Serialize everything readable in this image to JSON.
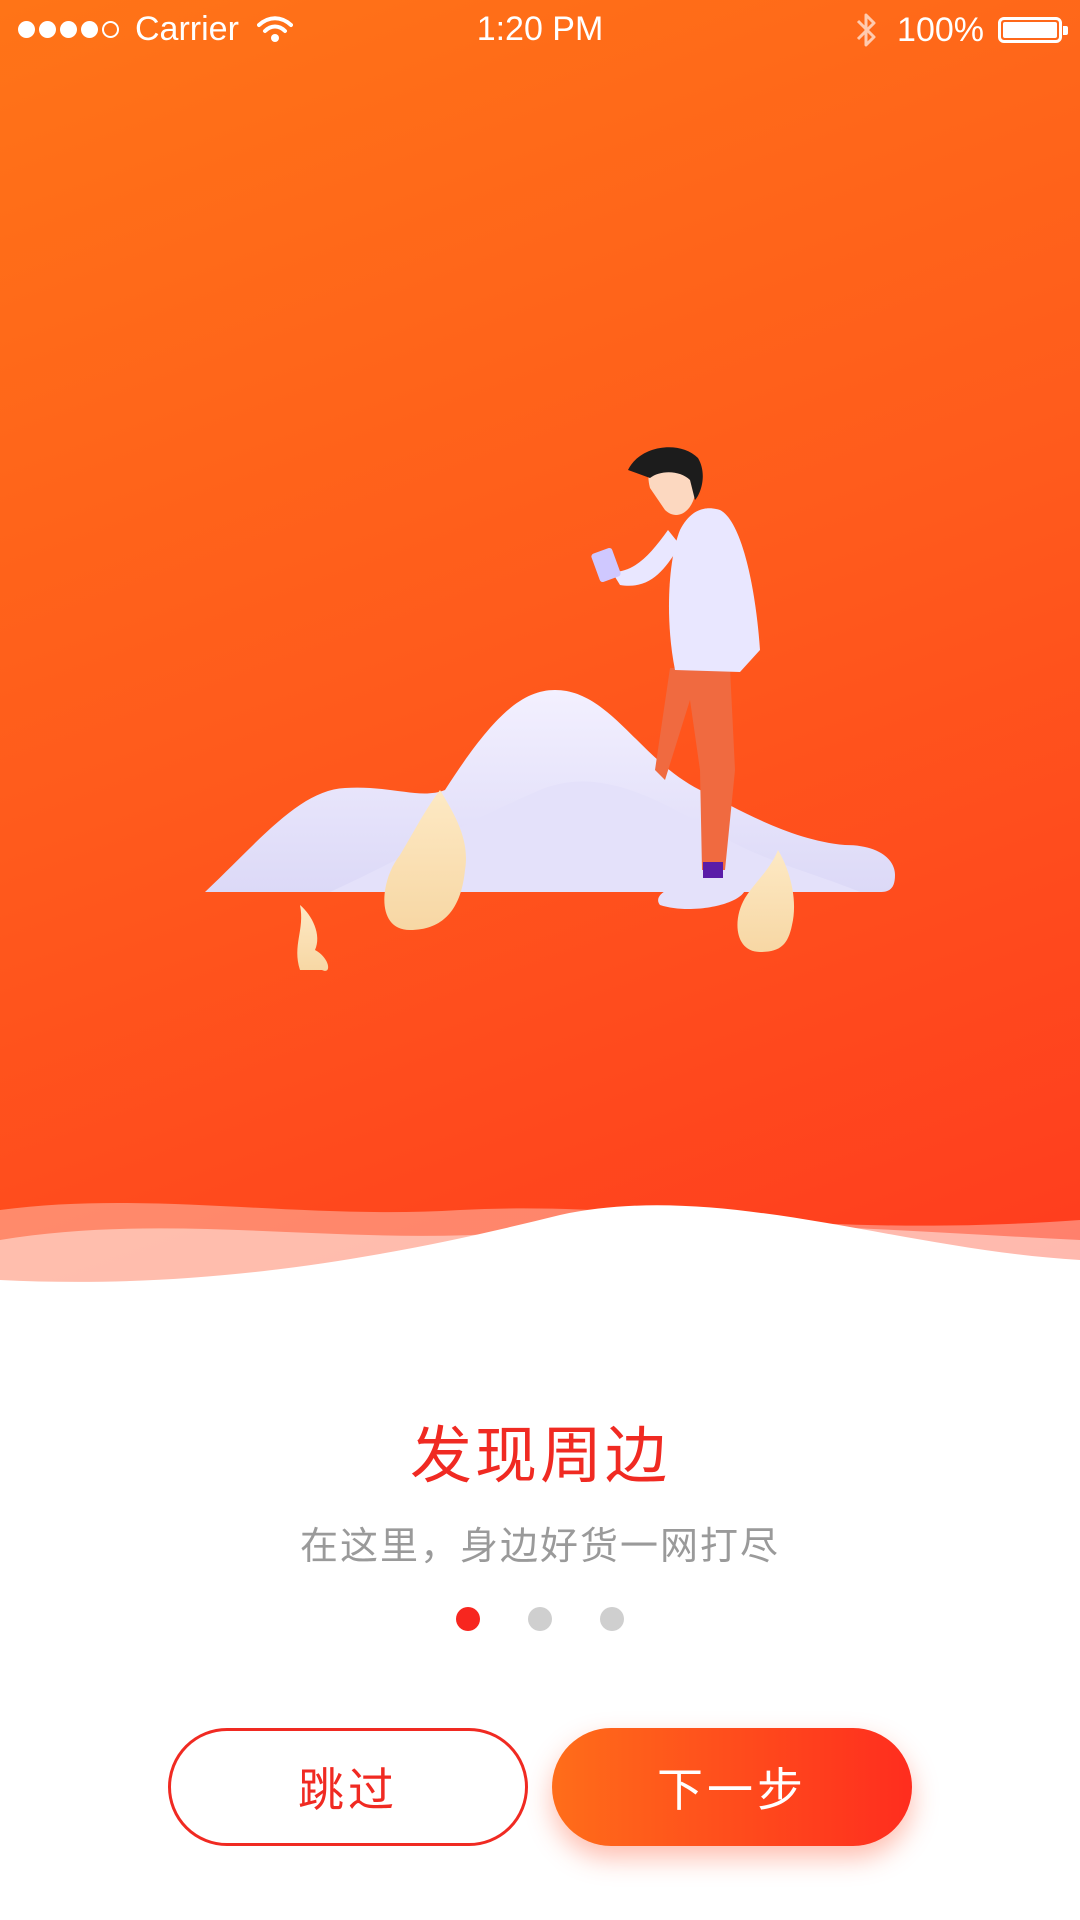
{
  "status_bar": {
    "carrier": "Carrier",
    "time": "1:20 PM",
    "battery": "100%",
    "signal_icon": "signal-dots-icon",
    "wifi_icon": "wifi-icon",
    "bluetooth_icon": "bluetooth-icon",
    "battery_icon": "battery-icon",
    "signal_bars_filled": 4,
    "signal_bars_total": 5
  },
  "onboarding": {
    "title": "发现周边",
    "subtitle": "在这里，身边好货一网打尽",
    "current_page": 1,
    "page_count": 3
  },
  "buttons": {
    "skip": "跳过",
    "next": "下一步"
  },
  "colors": {
    "hero_gradient_start": "#ff7417",
    "hero_gradient_end": "#ff3b1e",
    "accent_red": "#f02a22",
    "active_dot": "#f7261f",
    "inactive_dot": "#cfcfcf",
    "subtitle_gray": "#9a9a9a"
  }
}
